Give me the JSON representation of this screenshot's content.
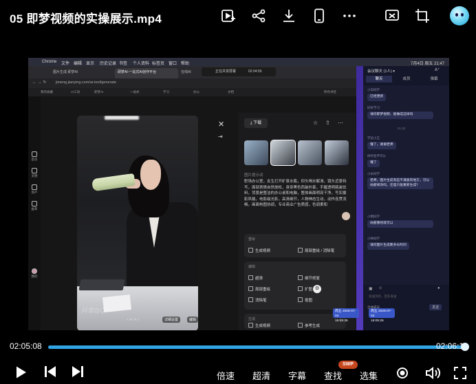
{
  "header": {
    "title": "05 即梦视频的实操展示.mp4"
  },
  "icons": [
    "video-play-icon",
    "share-icon",
    "download-icon",
    "phone-icon",
    "more-icon",
    "screen-cast-icon",
    "crop-icon",
    "avatar"
  ],
  "frame": {
    "mac_menu": [
      "Chrome",
      "文件",
      "编辑",
      "显示",
      "历史记录",
      "书签",
      "个人资料",
      "标签页",
      "窗口",
      "帮助"
    ],
    "mac_clock": "7月4日 周五 21:47",
    "tabs": [
      "图片生成-即梦AI",
      "即梦AI-一站式AI创作平台",
      "在线AI"
    ],
    "recording": {
      "label": "正在共享屏幕",
      "time": "02:04:59"
    },
    "url": "jimeng.jianying.com/ai-tool/generate",
    "bookmarks": [
      "我的收藏",
      "AI工具",
      "即梦AI",
      "一站式",
      "学习",
      "办公",
      "文档",
      "所有书签"
    ],
    "sidebar": [
      "首页",
      "灵感",
      "资产",
      "画布",
      "我的"
    ],
    "image_watermark": "抖音@Q",
    "pager": "< 4 / 4 >",
    "photo_buttons": [
      "详细设置",
      "编辑"
    ],
    "panel": {
      "download": "下载",
      "section_prompt": "图片提示词",
      "prompt_text": "职场办公室，女生打开矿泉水瓶，仰头喝水解渴，镜头近景特写，面部表情自然放松，身穿黑色西装外套，手握透明瓶装饮料，背景是整洁的办公桌和电脑，整体画面明亮干净，写实摄影风格，电影级光影，高清细节，人物神态生动，动作连贯流畅，画面构图协调，专业商业广告质感，色调柔和",
      "cards": [
        {
          "head": "重绘",
          "items": [
            "生成视频",
            "局部重绘 / 消除笔"
          ]
        },
        {
          "head": "编辑",
          "items": [
            "超清",
            "细节修复",
            "局部重绘",
            "扩图",
            "消除笔",
            "抠图"
          ]
        },
        {
          "head": "生成",
          "items": [
            "生成视频",
            "参考生成"
          ]
        }
      ]
    },
    "chat": {
      "title": "会议聊天 (1人) ▾",
      "tabs": [
        "聊天",
        "成员",
        "弹幕"
      ],
      "messages": [
        {
          "name": "小白同学",
          "text": "已经更新"
        },
        {
          "name": "好好学习",
          "text": "请问即梦视频，能做成这样吗"
        },
        {
          "time": "21:42"
        },
        {
          "name": "学员小王",
          "text": "懂了，谢谢老师"
        },
        {
          "name": "你的名字可以",
          "text": "懂了"
        },
        {
          "name": "小米同学",
          "text": "老师，图片生成有些不满意的地方，可以局部修改吗，还是只能重新生成？"
        },
        {
          "name": "小明同学",
          "text": "局部重绘就可以"
        },
        {
          "name": "小林同学",
          "text": "请问图片生成要多长时间"
        }
      ],
      "input_placeholder": "发送消息，回车发送",
      "send": "发送",
      "footer_label": "全体成员",
      "bottom_chips": [
        {
          "line1": "周五",
          "line2": "2025-07-04",
          "line3": "16:05:26"
        },
        {
          "line1": "周五",
          "line2": "2025-07-04",
          "line3": "16:05:26"
        }
      ]
    }
  },
  "player": {
    "current_time": "02:05:08",
    "end_time": "02:06:19",
    "progress": 0.99,
    "controls": [
      "倍速",
      "超清",
      "字幕",
      "查找",
      "选集"
    ],
    "swp_badge": "SWP",
    "accent_color": "#31a4e4"
  }
}
